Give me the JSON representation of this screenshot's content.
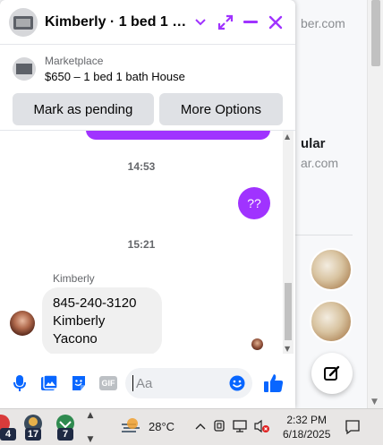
{
  "background": {
    "site_1": "ber.com",
    "title_2": "ular",
    "site_2": "ar.com"
  },
  "chat": {
    "title": "Kimberly · 1 bed 1 bath House",
    "listing": {
      "source": "Marketplace",
      "price_title": "$650 – 1 bed 1 bath House",
      "mark_pending_label": "Mark as pending",
      "more_options_label": "More Options"
    },
    "messages": {
      "timestamp_1": "14:53",
      "outgoing_text": "??",
      "timestamp_2": "15:21",
      "sender_name": "Kimberly",
      "incoming_line_1": "845-240-3120",
      "incoming_line_2": "Kimberly Yacono"
    },
    "composer": {
      "placeholder": "Aa",
      "gif_label": "GIF"
    },
    "accent_color": "#a033ff",
    "icon_color": "#0866ff"
  },
  "taskbar": {
    "apps": [
      {
        "badge": "4"
      },
      {
        "badge": "17"
      },
      {
        "badge": "7"
      }
    ],
    "temperature": "28°C",
    "time": "2:32 PM",
    "date": "6/18/2025"
  }
}
